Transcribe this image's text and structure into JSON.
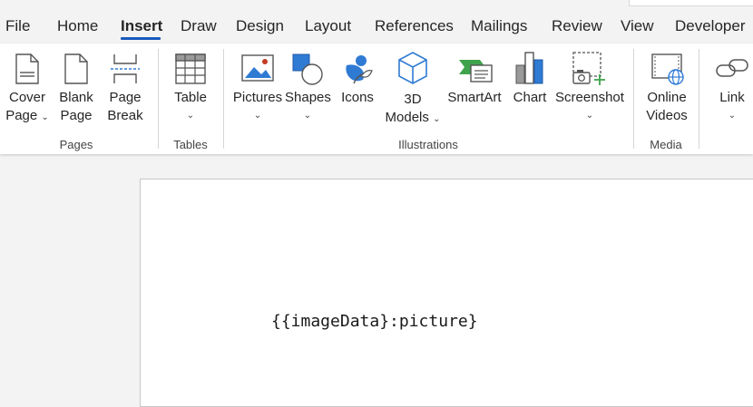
{
  "tabs": [
    {
      "label": "File"
    },
    {
      "label": "Home"
    },
    {
      "label": "Insert"
    },
    {
      "label": "Draw"
    },
    {
      "label": "Design"
    },
    {
      "label": "Layout"
    },
    {
      "label": "References"
    },
    {
      "label": "Mailings"
    },
    {
      "label": "Review"
    },
    {
      "label": "View"
    },
    {
      "label": "Developer"
    }
  ],
  "ribbon": {
    "pages": {
      "group_label": "Pages",
      "cover_page": {
        "line1": "Cover",
        "line2": "Page",
        "icon": "cover-page-icon"
      },
      "blank_page": {
        "line1": "Blank",
        "line2": "Page",
        "icon": "blank-page-icon"
      },
      "page_break": {
        "line1": "Page",
        "line2": "Break",
        "icon": "page-break-icon"
      }
    },
    "tables": {
      "group_label": "Tables",
      "table": {
        "line1": "Table",
        "icon": "table-icon"
      }
    },
    "illustrations": {
      "group_label": "Illustrations",
      "pictures": {
        "line1": "Pictures",
        "icon": "pictures-icon"
      },
      "shapes": {
        "line1": "Shapes",
        "icon": "shapes-icon"
      },
      "icons": {
        "line1": "Icons",
        "icon": "icons-icon"
      },
      "models3d": {
        "line1": "3D",
        "line2": "Models",
        "icon": "3d-models-icon"
      },
      "smartart": {
        "line1": "SmartArt",
        "icon": "smartart-icon"
      },
      "chart": {
        "line1": "Chart",
        "icon": "chart-icon"
      },
      "screenshot": {
        "line1": "Screenshot",
        "icon": "screenshot-icon"
      }
    },
    "media": {
      "group_label": "Media",
      "online_videos": {
        "line1": "Online",
        "line2": "Videos",
        "icon": "online-videos-icon"
      }
    },
    "links": {
      "link": {
        "line1": "Link",
        "icon": "link-icon"
      }
    }
  },
  "document": {
    "text": "{{imageData}:picture}"
  },
  "colors": {
    "accent": "#185abd",
    "chart_blue": "#2f7bd4",
    "smartart_green": "#3fa34d"
  }
}
